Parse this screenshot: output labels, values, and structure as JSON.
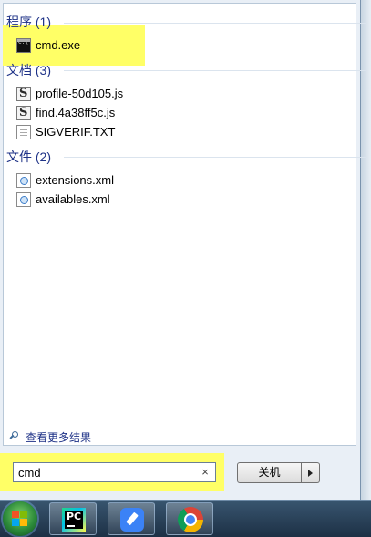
{
  "results": {
    "groups": [
      {
        "header": "程序 (1)",
        "items": [
          {
            "label": "cmd.exe",
            "icon": "cmd-icon"
          }
        ]
      },
      {
        "header": "文档 (3)",
        "items": [
          {
            "label": "profile-50d105.js",
            "icon": "js-file-icon"
          },
          {
            "label": "find.4a38ff5c.js",
            "icon": "js-file-icon"
          },
          {
            "label": "SIGVERIF.TXT",
            "icon": "text-file-icon"
          }
        ]
      },
      {
        "header": "文件 (2)",
        "items": [
          {
            "label": "extensions.xml",
            "icon": "xml-file-icon"
          },
          {
            "label": "availables.xml",
            "icon": "xml-file-icon"
          }
        ]
      }
    ],
    "more_results": "查看更多结果"
  },
  "search": {
    "value": "cmd",
    "clear_glyph": "×"
  },
  "shutdown": {
    "label": "关机"
  },
  "taskbar": {
    "apps": [
      {
        "name": "PyCharm",
        "icon": "pycharm-icon",
        "glyph": "PC"
      },
      {
        "name": "Notes",
        "icon": "pen-app-icon"
      },
      {
        "name": "Chrome",
        "icon": "chrome-icon"
      }
    ]
  },
  "colors": {
    "highlight": "#ffff66",
    "group_header": "#1e3287"
  }
}
